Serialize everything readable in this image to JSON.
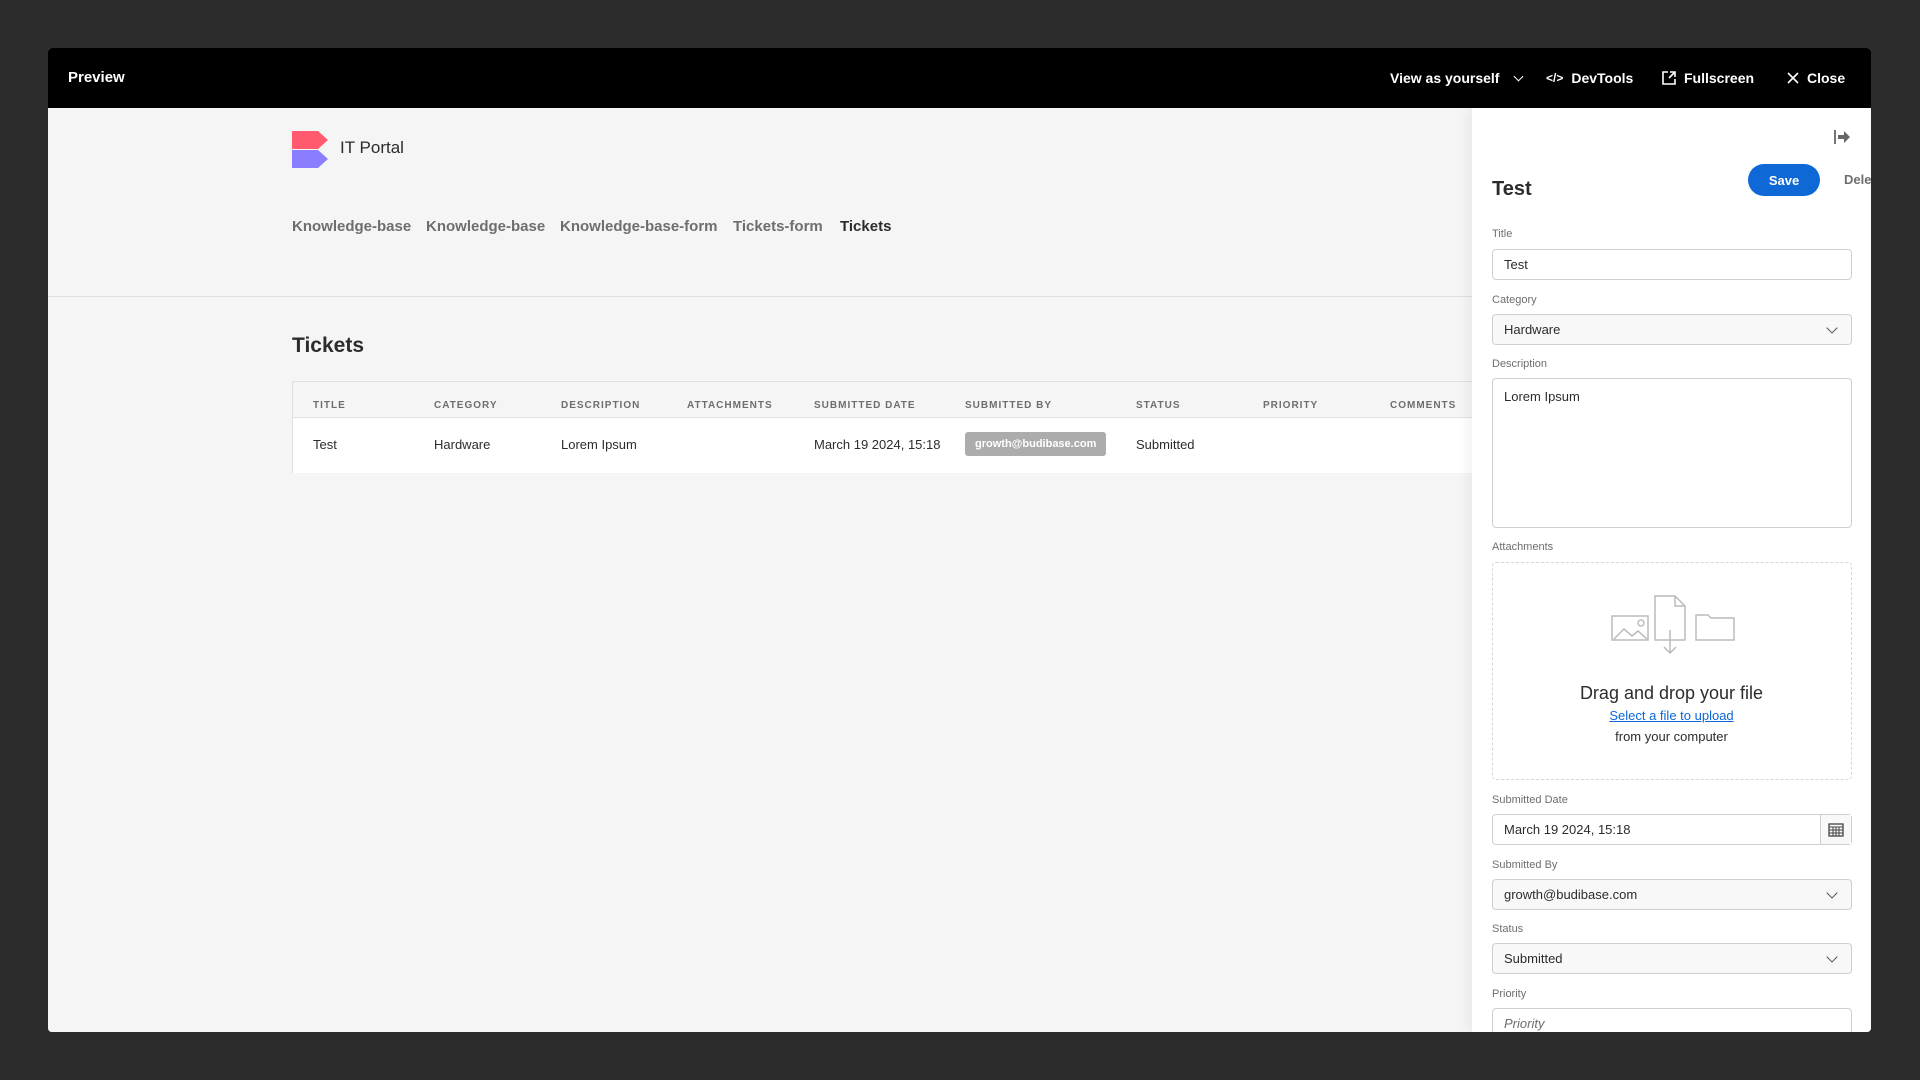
{
  "header": {
    "title": "Preview",
    "view_as": "View as yourself",
    "devtools": "DevTools",
    "fullscreen": "Fullscreen",
    "close": "Close"
  },
  "app": {
    "name": "IT Portal",
    "logo_colors": [
      "#ff5a6e",
      "#8b7dff"
    ],
    "nav": [
      "Knowledge-base",
      "Knowledge-base",
      "Knowledge-base-form",
      "Tickets-form",
      "Tickets"
    ],
    "active_nav": "Tickets",
    "heading": "Tickets",
    "table": {
      "columns": [
        "TITLE",
        "CATEGORY",
        "DESCRIPTION",
        "ATTACHMENTS",
        "SUBMITTED DATE",
        "SUBMITTED BY",
        "STATUS",
        "PRIORITY",
        "COMMENTS"
      ],
      "rows": [
        {
          "title": "Test",
          "category": "Hardware",
          "description": "Lorem Ipsum",
          "attachments": "",
          "submitted_date": "March 19 2024, 15:18",
          "submitted_by": "growth@budibase.com",
          "status": "Submitted",
          "priority": "",
          "comments": ""
        }
      ]
    }
  },
  "panel": {
    "title": "Test",
    "save": "Save",
    "delete": "Delete",
    "accent": "#0e68d6",
    "fields": {
      "title_label": "Title",
      "title_value": "Test",
      "category_label": "Category",
      "category_value": "Hardware",
      "description_label": "Description",
      "description_value": "Lorem Ipsum",
      "attachments_label": "Attachments",
      "drop_title": "Drag and drop your file",
      "drop_link": "Select a file to upload",
      "drop_sub": "from your computer",
      "date_label": "Submitted Date",
      "date_value": "March 19 2024, 15:18",
      "by_label": "Submitted By",
      "by_value": "growth@budibase.com",
      "status_label": "Status",
      "status_value": "Submitted",
      "priority_label": "Priority",
      "priority_placeholder": "Priority"
    }
  }
}
